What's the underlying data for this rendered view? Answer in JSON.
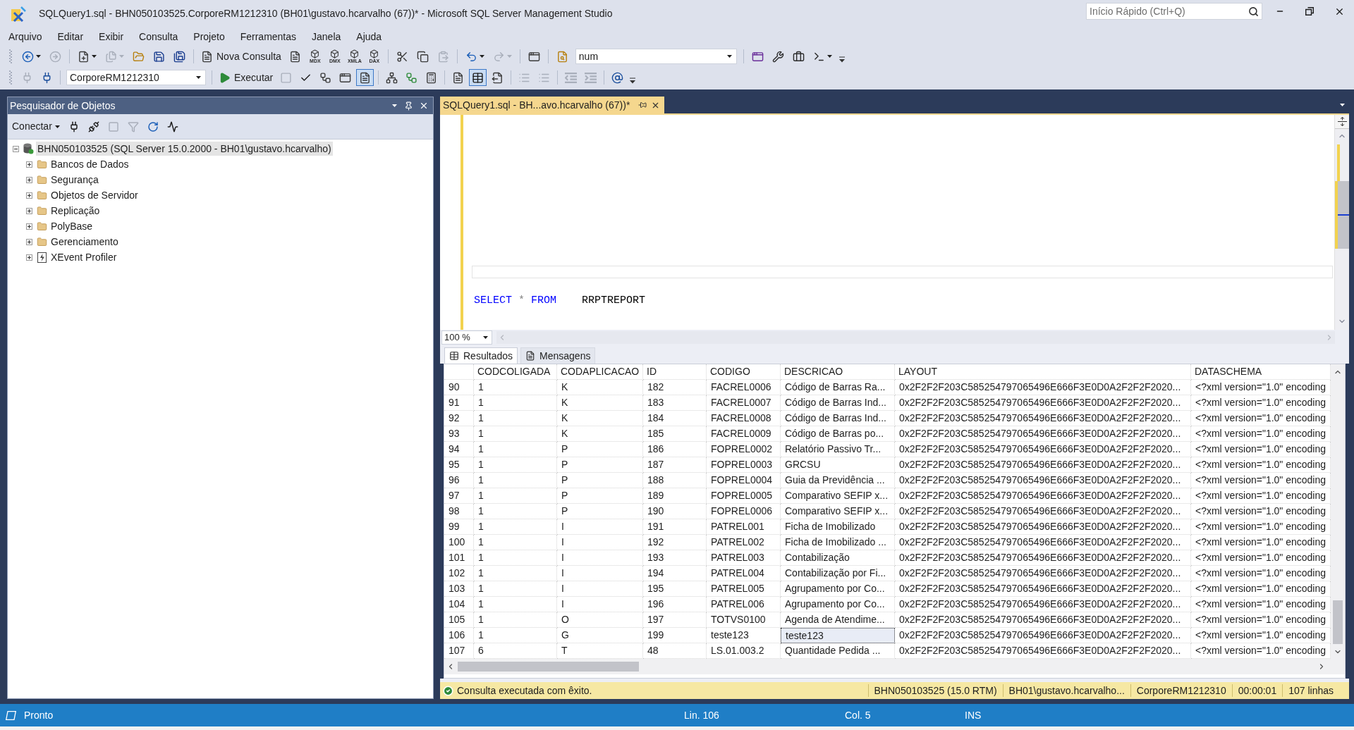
{
  "window": {
    "title": "SQLQuery1.sql - BHN050103525.CorporeRM1212310 (BH01\\gustavo.hcarvalho (67))* - Microsoft SQL Server Management Studio",
    "quick_launch": {
      "placeholder": "Início Rápido (Ctrl+Q)"
    }
  },
  "menu": [
    "Arquivo",
    "Editar",
    "Exibir",
    "Consulta",
    "Projeto",
    "Ferramentas",
    "Janela",
    "Ajuda"
  ],
  "toolbar_1": {
    "items": [
      {
        "kind": "icon",
        "disabled": false,
        "dropdown": true
      },
      {
        "kind": "icon",
        "disabled": true
      },
      {
        "kind": "icon",
        "disabled": false,
        "dropdown": true
      },
      {
        "kind": "icon",
        "disabled": true,
        "dropdown": true
      },
      {
        "kind": "icon",
        "disabled": false
      },
      {
        "kind": "icon",
        "disabled": false
      },
      {
        "kind": "icon",
        "disabled": false
      },
      {
        "kind": "labeled",
        "label": "Nova Consulta",
        "disabled": false
      },
      {
        "kind": "icon",
        "disabled": false
      },
      {
        "kind": "cube",
        "label": "MDX",
        "disabled": false
      },
      {
        "kind": "cube",
        "label": "DMX",
        "disabled": false
      },
      {
        "kind": "cube",
        "label": "XMLA",
        "disabled": false
      },
      {
        "kind": "cube",
        "label": "DAX",
        "disabled": false
      },
      {
        "kind": "icon",
        "disabled": false
      },
      {
        "kind": "icon",
        "disabled": false
      },
      {
        "kind": "icon",
        "disabled": true
      },
      {
        "kind": "icon",
        "disabled": false,
        "dropdown": true
      },
      {
        "kind": "icon",
        "disabled": true,
        "dropdown": true
      },
      {
        "kind": "icon",
        "disabled": false
      },
      {
        "kind": "icon",
        "disabled": false
      },
      {
        "kind": "combo",
        "value": "num"
      },
      {
        "kind": "icon",
        "disabled": false
      },
      {
        "kind": "icon",
        "disabled": false
      },
      {
        "kind": "icon",
        "disabled": false
      },
      {
        "kind": "icon",
        "disabled": false,
        "dropdown": true
      }
    ]
  },
  "toolbar_2": {
    "items": [
      {
        "kind": "icon",
        "disabled": true
      },
      {
        "kind": "icon",
        "disabled": false
      },
      {
        "kind": "combo",
        "value": "CorporeRM1212310"
      },
      {
        "kind": "labeled",
        "label": "Executar",
        "disabled": false
      },
      {
        "kind": "icon",
        "disabled": true
      },
      {
        "kind": "icon",
        "disabled": false
      },
      {
        "kind": "icon",
        "disabled": false
      },
      {
        "kind": "icon",
        "disabled": false
      },
      {
        "kind": "icon",
        "disabled": false,
        "checked": true
      },
      {
        "kind": "icon",
        "disabled": false
      },
      {
        "kind": "icon",
        "disabled": false
      },
      {
        "kind": "icon",
        "disabled": false
      },
      {
        "kind": "icon",
        "disabled": false
      },
      {
        "kind": "icon",
        "disabled": false,
        "checked": true
      },
      {
        "kind": "icon",
        "disabled": false
      },
      {
        "kind": "icon",
        "disabled": true
      },
      {
        "kind": "icon",
        "disabled": true
      },
      {
        "kind": "icon",
        "disabled": true
      },
      {
        "kind": "icon",
        "disabled": true
      },
      {
        "kind": "icon",
        "disabled": false
      }
    ]
  },
  "object_explorer": {
    "title": "Pesquisador de Objetos",
    "connect_button": {
      "label": "Conectar"
    },
    "tools": [
      {
        "disabled": false
      },
      {
        "disabled": false
      },
      {
        "disabled": true
      },
      {
        "disabled": true
      },
      {
        "disabled": false
      },
      {
        "disabled": false
      }
    ],
    "tree": [
      {
        "kind": "server",
        "label": "BHN050103525 (SQL Server 15.0.2000 - BH01\\gustavo.hcarvalho)",
        "expanded": true,
        "selected": true,
        "children": [
          {
            "kind": "folder",
            "label": "Bancos de Dados",
            "expanded": false,
            "selected": false
          },
          {
            "kind": "folder",
            "label": "Segurança",
            "expanded": false,
            "selected": false
          },
          {
            "kind": "folder",
            "label": "Objetos de Servidor",
            "expanded": false,
            "selected": false
          },
          {
            "kind": "folder",
            "label": "Replicação",
            "expanded": false,
            "selected": false
          },
          {
            "kind": "folder",
            "label": "PolyBase",
            "expanded": false,
            "selected": false
          },
          {
            "kind": "folder",
            "label": "Gerenciamento",
            "expanded": false,
            "selected": false
          },
          {
            "kind": "profiler",
            "label": "XEvent Profiler",
            "expanded": false,
            "selected": false
          }
        ]
      }
    ]
  },
  "editor": {
    "tab": {
      "label": "SQLQuery1.sql - BH...avo.hcarvalho (67))*",
      "selected": true
    },
    "lines": [
      {
        "tokens": [
          {
            "kind": "keyword",
            "text": "SELECT "
          },
          {
            "kind": "operator",
            "text": "* "
          },
          {
            "kind": "keyword",
            "text": "FROM    "
          },
          {
            "kind": "identifier",
            "text": "RRPTREPORT"
          }
        ]
      }
    ],
    "zoom": {
      "value": "100 %"
    }
  },
  "results": {
    "tabs": [
      {
        "label": "Resultados",
        "selected": true
      },
      {
        "label": "Mensagens",
        "selected": false
      }
    ],
    "columns": [
      "CODCOLIGADA",
      "CODAPLICACAO",
      "ID",
      "CODIGO",
      "DESCRICAO",
      "LAYOUT",
      "DATASCHEMA"
    ],
    "rows": [
      {
        "number": "90",
        "cells": [
          {
            "text": "1",
            "selected": false
          },
          {
            "text": "K",
            "selected": false
          },
          {
            "text": "182",
            "selected": false
          },
          {
            "text": "FACREL0006",
            "selected": false
          },
          {
            "text": "Código de Barras Ra...",
            "selected": false
          },
          {
            "text": "0x2F2F2F203C585254797065496E666F3E0D0A2F2F2F2020...",
            "selected": false
          },
          {
            "text": "<?xml version=\"1.0\" encoding",
            "selected": false
          }
        ]
      },
      {
        "number": "91",
        "cells": [
          {
            "text": "1",
            "selected": false
          },
          {
            "text": "K",
            "selected": false
          },
          {
            "text": "183",
            "selected": false
          },
          {
            "text": "FACREL0007",
            "selected": false
          },
          {
            "text": "Código de Barras Ind...",
            "selected": false
          },
          {
            "text": "0x2F2F2F203C585254797065496E666F3E0D0A2F2F2F2020...",
            "selected": false
          },
          {
            "text": "<?xml version=\"1.0\" encoding",
            "selected": false
          }
        ]
      },
      {
        "number": "92",
        "cells": [
          {
            "text": "1",
            "selected": false
          },
          {
            "text": "K",
            "selected": false
          },
          {
            "text": "184",
            "selected": false
          },
          {
            "text": "FACREL0008",
            "selected": false
          },
          {
            "text": "Código de Barras Ind...",
            "selected": false
          },
          {
            "text": "0x2F2F2F203C585254797065496E666F3E0D0A2F2F2F2020...",
            "selected": false
          },
          {
            "text": "<?xml version=\"1.0\" encoding",
            "selected": false
          }
        ]
      },
      {
        "number": "93",
        "cells": [
          {
            "text": "1",
            "selected": false
          },
          {
            "text": "K",
            "selected": false
          },
          {
            "text": "185",
            "selected": false
          },
          {
            "text": "FACREL0009",
            "selected": false
          },
          {
            "text": "Código de Barras po...",
            "selected": false
          },
          {
            "text": "0x2F2F2F203C585254797065496E666F3E0D0A2F2F2F2020...",
            "selected": false
          },
          {
            "text": "<?xml version=\"1.0\" encoding",
            "selected": false
          }
        ]
      },
      {
        "number": "94",
        "cells": [
          {
            "text": "1",
            "selected": false
          },
          {
            "text": "P",
            "selected": false
          },
          {
            "text": "186",
            "selected": false
          },
          {
            "text": "FOPREL0002",
            "selected": false
          },
          {
            "text": "Relatório Passivo Tr...",
            "selected": false
          },
          {
            "text": "0x2F2F2F203C585254797065496E666F3E0D0A2F2F2F2020...",
            "selected": false
          },
          {
            "text": "<?xml version=\"1.0\" encoding",
            "selected": false
          }
        ]
      },
      {
        "number": "95",
        "cells": [
          {
            "text": "1",
            "selected": false
          },
          {
            "text": "P",
            "selected": false
          },
          {
            "text": "187",
            "selected": false
          },
          {
            "text": "FOPREL0003",
            "selected": false
          },
          {
            "text": "GRCSU",
            "selected": false
          },
          {
            "text": "0x2F2F2F203C585254797065496E666F3E0D0A2F2F2F2020...",
            "selected": false
          },
          {
            "text": "<?xml version=\"1.0\" encoding",
            "selected": false
          }
        ]
      },
      {
        "number": "96",
        "cells": [
          {
            "text": "1",
            "selected": false
          },
          {
            "text": "P",
            "selected": false
          },
          {
            "text": "188",
            "selected": false
          },
          {
            "text": "FOPREL0004",
            "selected": false
          },
          {
            "text": "Guia da Previdência ...",
            "selected": false
          },
          {
            "text": "0x2F2F2F203C585254797065496E666F3E0D0A2F2F2F2020...",
            "selected": false
          },
          {
            "text": "<?xml version=\"1.0\" encoding",
            "selected": false
          }
        ]
      },
      {
        "number": "97",
        "cells": [
          {
            "text": "1",
            "selected": false
          },
          {
            "text": "P",
            "selected": false
          },
          {
            "text": "189",
            "selected": false
          },
          {
            "text": "FOPREL0005",
            "selected": false
          },
          {
            "text": "Comparativo SEFIP x...",
            "selected": false
          },
          {
            "text": "0x2F2F2F203C585254797065496E666F3E0D0A2F2F2F2020...",
            "selected": false
          },
          {
            "text": "<?xml version=\"1.0\" encoding",
            "selected": false
          }
        ]
      },
      {
        "number": "98",
        "cells": [
          {
            "text": "1",
            "selected": false
          },
          {
            "text": "P",
            "selected": false
          },
          {
            "text": "190",
            "selected": false
          },
          {
            "text": "FOPREL0006",
            "selected": false
          },
          {
            "text": "Comparativo SEFIP x...",
            "selected": false
          },
          {
            "text": "0x2F2F2F203C585254797065496E666F3E0D0A2F2F2F2020...",
            "selected": false
          },
          {
            "text": "<?xml version=\"1.0\" encoding",
            "selected": false
          }
        ]
      },
      {
        "number": "99",
        "cells": [
          {
            "text": "1",
            "selected": false
          },
          {
            "text": "I",
            "selected": false
          },
          {
            "text": "191",
            "selected": false
          },
          {
            "text": "PATREL001",
            "selected": false
          },
          {
            "text": "Ficha de Imobilizado",
            "selected": false
          },
          {
            "text": "0x2F2F2F203C585254797065496E666F3E0D0A2F2F2F2020...",
            "selected": false
          },
          {
            "text": "<?xml version=\"1.0\" encoding",
            "selected": false
          }
        ]
      },
      {
        "number": "100",
        "cells": [
          {
            "text": "1",
            "selected": false
          },
          {
            "text": "I",
            "selected": false
          },
          {
            "text": "192",
            "selected": false
          },
          {
            "text": "PATREL002",
            "selected": false
          },
          {
            "text": "Ficha de Imobilizado ...",
            "selected": false
          },
          {
            "text": "0x2F2F2F203C585254797065496E666F3E0D0A2F2F2F2020...",
            "selected": false
          },
          {
            "text": "<?xml version=\"1.0\" encoding",
            "selected": false
          }
        ]
      },
      {
        "number": "101",
        "cells": [
          {
            "text": "1",
            "selected": false
          },
          {
            "text": "I",
            "selected": false
          },
          {
            "text": "193",
            "selected": false
          },
          {
            "text": "PATREL003",
            "selected": false
          },
          {
            "text": "Contabilização",
            "selected": false
          },
          {
            "text": "0x2F2F2F203C585254797065496E666F3E0D0A2F2F2F2020...",
            "selected": false
          },
          {
            "text": "<?xml version=\"1.0\" encoding",
            "selected": false
          }
        ]
      },
      {
        "number": "102",
        "cells": [
          {
            "text": "1",
            "selected": false
          },
          {
            "text": "I",
            "selected": false
          },
          {
            "text": "194",
            "selected": false
          },
          {
            "text": "PATREL004",
            "selected": false
          },
          {
            "text": "Contabilização por Fi...",
            "selected": false
          },
          {
            "text": "0x2F2F2F203C585254797065496E666F3E0D0A2F2F2F2020...",
            "selected": false
          },
          {
            "text": "<?xml version=\"1.0\" encoding",
            "selected": false
          }
        ]
      },
      {
        "number": "103",
        "cells": [
          {
            "text": "1",
            "selected": false
          },
          {
            "text": "I",
            "selected": false
          },
          {
            "text": "195",
            "selected": false
          },
          {
            "text": "PATREL005",
            "selected": false
          },
          {
            "text": "Agrupamento por Co...",
            "selected": false
          },
          {
            "text": "0x2F2F2F203C585254797065496E666F3E0D0A2F2F2F2020...",
            "selected": false
          },
          {
            "text": "<?xml version=\"1.0\" encoding",
            "selected": false
          }
        ]
      },
      {
        "number": "104",
        "cells": [
          {
            "text": "1",
            "selected": false
          },
          {
            "text": "I",
            "selected": false
          },
          {
            "text": "196",
            "selected": false
          },
          {
            "text": "PATREL006",
            "selected": false
          },
          {
            "text": "Agrupamento por Co...",
            "selected": false
          },
          {
            "text": "0x2F2F2F203C585254797065496E666F3E0D0A2F2F2F2020...",
            "selected": false
          },
          {
            "text": "<?xml version=\"1.0\" encoding",
            "selected": false
          }
        ]
      },
      {
        "number": "105",
        "cells": [
          {
            "text": "1",
            "selected": false
          },
          {
            "text": "O",
            "selected": false
          },
          {
            "text": "197",
            "selected": false
          },
          {
            "text": "TOTVS0100",
            "selected": false
          },
          {
            "text": "Agenda de Atendime...",
            "selected": false
          },
          {
            "text": "0x2F2F2F203C585254797065496E666F3E0D0A2F2F2F2020...",
            "selected": false
          },
          {
            "text": "<?xml version=\"1.0\" encoding",
            "selected": false
          }
        ]
      },
      {
        "number": "106",
        "cells": [
          {
            "text": "1",
            "selected": false
          },
          {
            "text": "G",
            "selected": false
          },
          {
            "text": "199",
            "selected": false
          },
          {
            "text": "teste123",
            "selected": false
          },
          {
            "text": "teste123",
            "selected": true
          },
          {
            "text": "0x2F2F2F203C585254797065496E666F3E0D0A2F2F2F2020...",
            "selected": false
          },
          {
            "text": "<?xml version=\"1.0\" encoding",
            "selected": false
          }
        ]
      },
      {
        "number": "107",
        "cells": [
          {
            "text": "6",
            "selected": false
          },
          {
            "text": "T",
            "selected": false
          },
          {
            "text": "48",
            "selected": false
          },
          {
            "text": "LS.01.003.2",
            "selected": false
          },
          {
            "text": "Quantidade Pedida ...",
            "selected": false
          },
          {
            "text": "0x2F2F2F203C585254797065496E666F3E0D0A2F2F2F2020...",
            "selected": false
          },
          {
            "text": "<?xml version=\"1.0\" encoding",
            "selected": false
          }
        ]
      }
    ]
  },
  "query_status": {
    "kind": "success",
    "message": "Consulta executada com êxito.",
    "items": [
      "BHN050103525 (15.0 RTM)",
      "BH01\\gustavo.hcarvalho...",
      "CorporeRM1212310",
      "00:00:01",
      "107 linhas"
    ]
  },
  "status_bar": {
    "state": "Pronto",
    "line": "Lin. 106",
    "column": "Col. 5",
    "mode": "INS"
  }
}
